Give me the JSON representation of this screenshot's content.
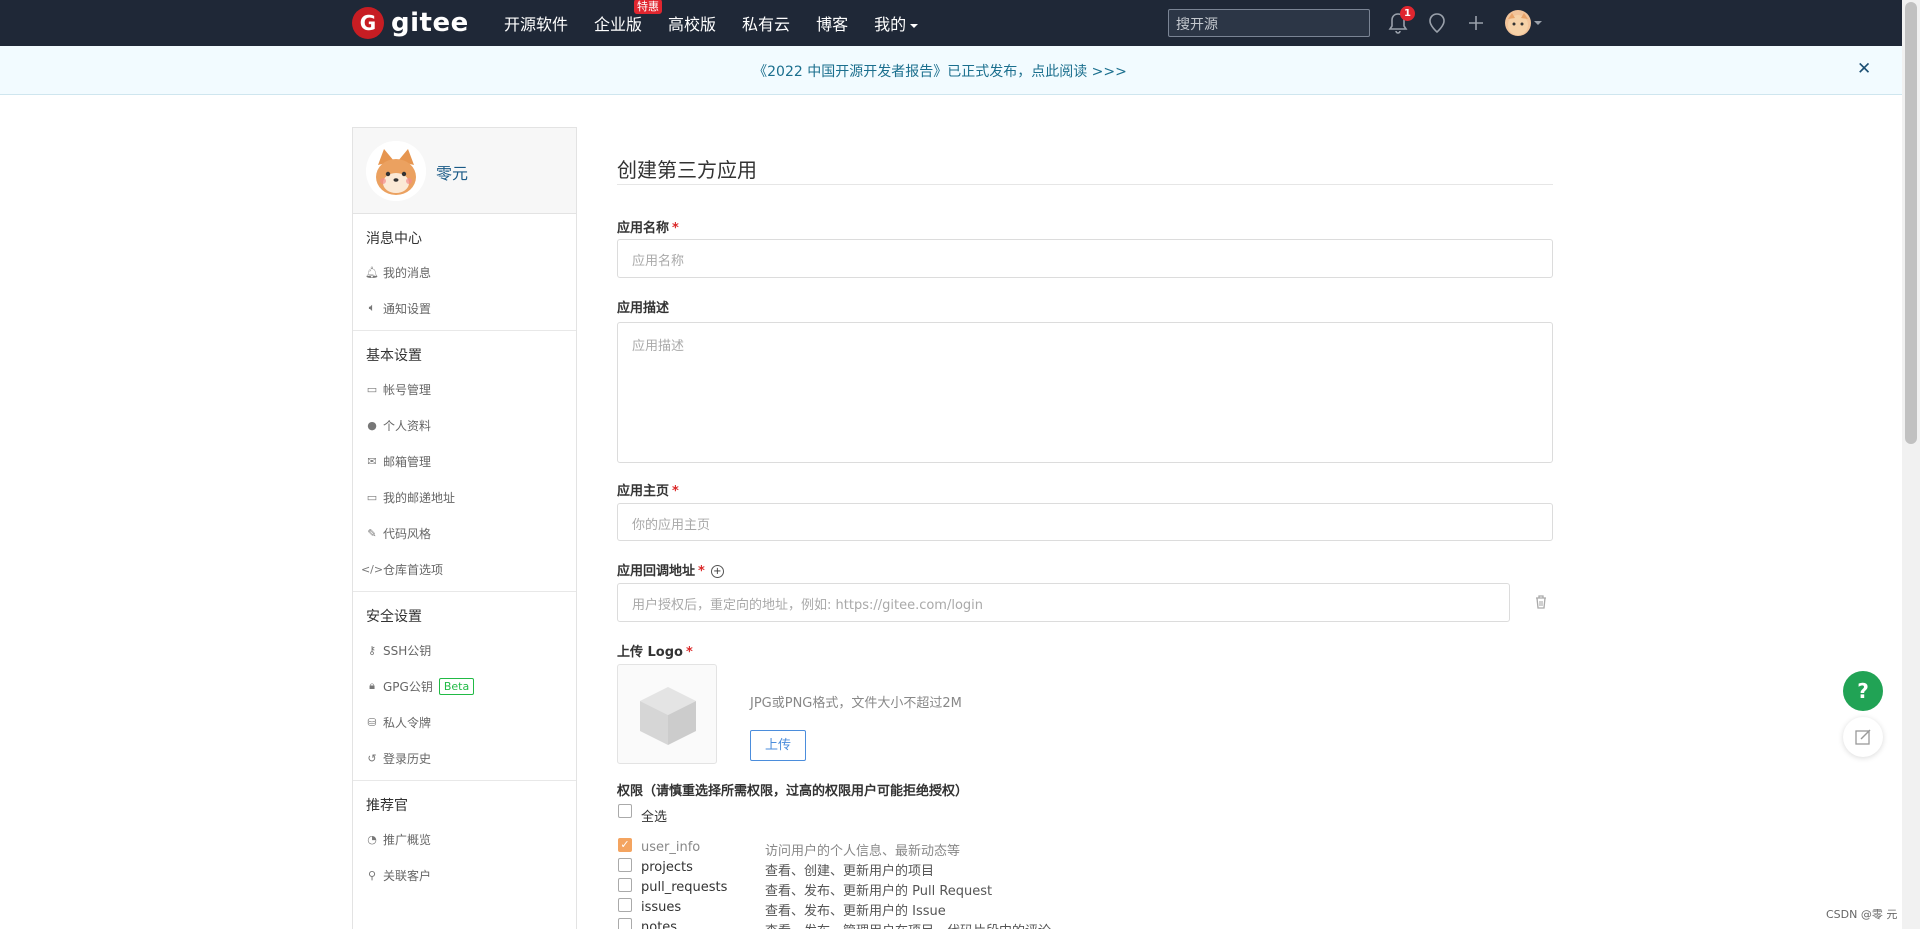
{
  "navbar": {
    "logo_mark": "G",
    "logo_text": "gitee",
    "links": [
      "开源软件",
      "企业版",
      "高校版",
      "私有云",
      "博客",
      "我的"
    ],
    "enterprise_badge": "特惠",
    "search_placeholder": "搜开源",
    "notification_count": "1"
  },
  "announcement": {
    "text": "《2022 中国开源开发者报告》已正式发布，点此阅读 >>>",
    "close": "✕"
  },
  "sidebar": {
    "username": "零元",
    "sections": [
      {
        "title": "消息中心",
        "items": [
          "我的消息",
          "通知设置"
        ]
      },
      {
        "title": "基本设置",
        "items": [
          "帐号管理",
          "个人资料",
          "邮箱管理",
          "我的邮递地址",
          "代码风格",
          "仓库首选项"
        ]
      },
      {
        "title": "安全设置",
        "items": [
          "SSH公钥",
          "GPG公钥",
          "私人令牌",
          "登录历史"
        ]
      },
      {
        "title": "推荐官",
        "items": [
          "推广概览",
          "关联客户"
        ]
      }
    ],
    "gpg_badge": "Beta"
  },
  "form": {
    "title": "创建第三方应用",
    "name_label": "应用名称",
    "name_placeholder": "应用名称",
    "desc_label": "应用描述",
    "desc_placeholder": "应用描述",
    "home_label": "应用主页",
    "home_placeholder": "你的应用主页",
    "callback_label": "应用回调地址",
    "callback_placeholder": "用户授权后，重定向的地址，例如: https://gitee.com/login",
    "logo_label": "上传 Logo",
    "logo_hint": "JPG或PNG格式，文件大小不超过2M",
    "upload_button": "上传",
    "required_mark": "*",
    "permissions_title": "权限（请慎重选择所需权限，过高的权限用户可能拒绝授权）",
    "select_all": "全选",
    "permissions": [
      {
        "name": "user_info",
        "desc": "访问用户的个人信息、最新动态等",
        "checked": true
      },
      {
        "name": "projects",
        "desc": "查看、创建、更新用户的项目",
        "checked": false
      },
      {
        "name": "pull_requests",
        "desc": "查看、发布、更新用户的 Pull Request",
        "checked": false
      },
      {
        "name": "issues",
        "desc": "查看、发布、更新用户的 Issue",
        "checked": false
      },
      {
        "name": "notes",
        "desc": "查看、发布、管理用户在项目、代码片段中的评论",
        "checked": false
      }
    ]
  },
  "float": {
    "help": "?"
  },
  "watermark": "CSDN @零 元"
}
